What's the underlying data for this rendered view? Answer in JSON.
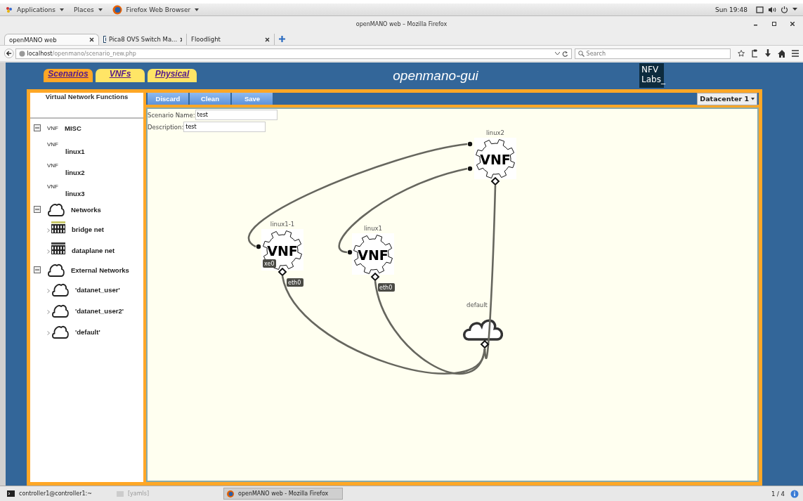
{
  "top_bar": {
    "menus": [
      "Applications",
      "Places",
      "Firefox Web Browser"
    ],
    "clock": "Sun 19:48"
  },
  "window": {
    "title": "openMANO web – Mozilla Firefox"
  },
  "browser_tabs": [
    {
      "label": "openMANO web",
      "selected": true,
      "favicon": false
    },
    {
      "label": "Pica8 OVS Switch Ma...",
      "selected": false,
      "favicon": true
    },
    {
      "label": "Floodlight",
      "selected": false,
      "favicon": false
    }
  ],
  "address_bar": {
    "host": "localhost",
    "path": "/openmano/scenario_new.php"
  },
  "search": {
    "placeholder": "Search"
  },
  "app": {
    "title": "openmano-gui",
    "logo": [
      "NFV",
      "Labs_"
    ],
    "tabs": [
      {
        "label": "Scenarios",
        "selected": true
      },
      {
        "label": "VNFs",
        "selected": false
      },
      {
        "label": "Physical",
        "selected": false
      }
    ],
    "toolbar": [
      "Discard",
      "Clean",
      "Save"
    ],
    "datacenter": "Datacenter 1"
  },
  "sidebar": {
    "title": "Virtual Network Functions",
    "groups": [
      {
        "label": "MISC",
        "kind": "vnf",
        "badge": "VNF",
        "expanded": true,
        "children": [
          {
            "label": "linux1",
            "kind": "vnf",
            "badge": "VNF"
          },
          {
            "label": "linux2",
            "kind": "vnf",
            "badge": "VNF"
          },
          {
            "label": "linux3",
            "kind": "vnf",
            "badge": "VNF"
          }
        ]
      },
      {
        "label": "Networks",
        "kind": "cloud",
        "expanded": true,
        "children": [
          {
            "label": "bridge net",
            "kind": "switch",
            "expanded": false
          },
          {
            "label": "dataplane net",
            "kind": "switch",
            "expanded": false
          }
        ]
      },
      {
        "label": "External Networks",
        "kind": "cloud",
        "expanded": true,
        "children": [
          {
            "label": "'datanet_user'",
            "kind": "cloud",
            "expanded": false
          },
          {
            "label": "'datanet_user2'",
            "kind": "cloud",
            "expanded": false
          },
          {
            "label": "'default'",
            "kind": "cloud",
            "expanded": false
          }
        ]
      }
    ]
  },
  "form": {
    "fields": [
      {
        "label": "Scenario Name:",
        "value": "test"
      },
      {
        "label": "Description:",
        "value": "test"
      }
    ]
  },
  "diagram": {
    "nodes": [
      {
        "label": "linux2",
        "kind": "vnf",
        "badge": "VNF"
      },
      {
        "label": "linux1-1",
        "kind": "vnf",
        "badge": "VNF",
        "port_labels": [
          "xe0",
          "eth0"
        ]
      },
      {
        "label": "linux1",
        "kind": "vnf",
        "badge": "VNF",
        "port_labels": [
          "eth0"
        ]
      },
      {
        "label": "default",
        "kind": "network"
      }
    ]
  },
  "taskbar": {
    "items": [
      {
        "label": "controller1@controller1:~",
        "selected": false
      },
      {
        "label": "[yamls]",
        "selected": false
      },
      {
        "label": "openMANO web - Mozilla Firefox",
        "selected": true
      }
    ],
    "workspace": "1 / 4"
  }
}
